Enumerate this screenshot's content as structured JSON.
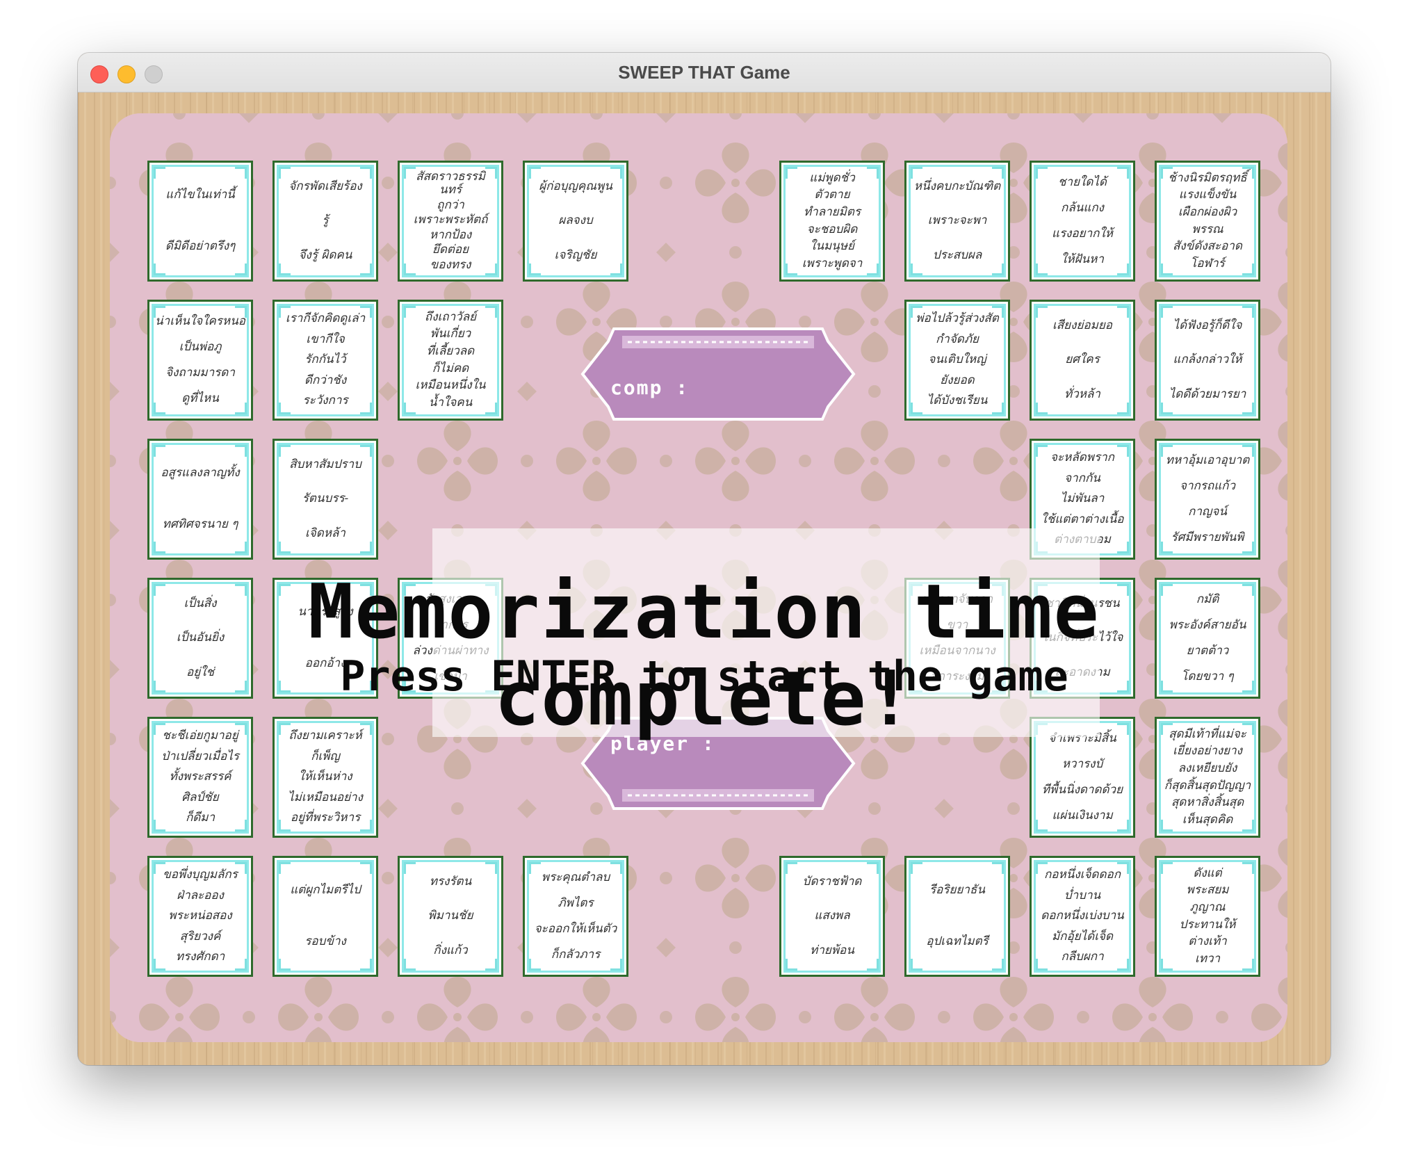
{
  "window": {
    "title": "SWEEP THAT Game"
  },
  "labels": {
    "comp": "comp :",
    "player": "player :"
  },
  "message": {
    "main": "Memorization time complete!",
    "sub": "Press ENTER to start the game"
  },
  "cards": [
    {
      "lines": [
        "แก้ไขในเท่านี้",
        "ดีมิดีอย่าตรึงๆ"
      ]
    },
    {
      "lines": [
        "จักรพัดเสียร้อง",
        "รู้",
        "จึงรู้ ผิดคน"
      ]
    },
    {
      "lines": [
        "สัสดราวธรรมินทร์",
        "ถูกว่า",
        "เพราะพระหัตถ์",
        "หากป้อง",
        "ยึดต่อย",
        "ของทรง"
      ]
    },
    {
      "lines": [
        "ผู้ก่อบุญคุณพูน",
        "ผลจงบ",
        "เจริญชัย"
      ]
    },
    {
      "lines": [
        "แม่พูดชั่ว",
        "ตัวตาย",
        "ทำลายมิตร",
        "จะชอบผิด",
        "ในมนุษย์",
        "เพราะพูดจา"
      ]
    },
    {
      "lines": [
        "หนึ่งคบกะบัณฑิต",
        "เพราะจะพา",
        "ประสบผล"
      ]
    },
    {
      "lines": [
        "ชายใดได้",
        "กล้นแกง",
        "แรงอยากให้",
        "ให้ฝันหา"
      ]
    },
    {
      "lines": [
        "ช้างนิรมิตรฤทธิ์",
        "แรงแข็งขัน",
        "เผือกผ่องผิว",
        "พรรณ",
        "สังข์ดังสะอาด",
        "โอฬาร์"
      ]
    },
    {
      "lines": [
        "น่าเห็นใจใครหนอ",
        "เป็นพ่อภู",
        "จิงถามมารดา",
        "ดูที่ไหน"
      ]
    },
    {
      "lines": [
        "เรากีจักคิดดูเล่า",
        "เขากีใจ",
        "รักกันไว้",
        "ดีกว่าชัง",
        "ระวังการ"
      ]
    },
    {
      "lines": [
        "ถึงเถาวัลย์",
        "พันเกี่ยว",
        "ที่เลี้ยวลด",
        "ก็ไม่คด",
        "เหมือนหนึ่งใน",
        "น้ำใจคน"
      ]
    },
    {
      "lines": [
        "พ่อไปล้วรู้ส่วงสัต",
        "กำจัดภัย",
        "จนเติบใหญ่",
        "ยังยอด",
        "ได้บังชเรียน"
      ]
    },
    {
      "lines": [
        "เสียงย่อมยอ",
        "ยศใคร",
        "ทั่วหล้า"
      ]
    },
    {
      "lines": [
        "ได้ฟังอรู้ก็ดีใจ",
        "แกล้งกล่าวให้",
        "ไดดีด้วยมารยา"
      ]
    },
    {
      "lines": [
        "อสูรแลงลาญทั้ง",
        "ทศทิศจรนาย ๆ"
      ]
    },
    {
      "lines": [
        "สิบหาสัมปราบ",
        "รัตนบรร-",
        "เจิดหล้า"
      ]
    },
    {
      "lines": [
        "จะหลัดพราก",
        "จากกัน",
        "ไม่พันลา",
        "ใช้แต่ตาต่างเนื้อ",
        "ต่างตาบอม"
      ]
    },
    {
      "lines": [
        "ทหาอุ้มเอาอุบาต",
        "จากรถแก้ว",
        "กาญจน์",
        "รัศมีพรายพันพิ"
      ]
    },
    {
      "lines": [
        "เป็นสิ่ง",
        "เป็นอันยิ่ง",
        "อยู่ใช่"
      ]
    },
    {
      "lines": [
        "นามระสูยิ่ง",
        "ออกอ้าง"
      ]
    },
    {
      "lines": [
        "สังสูงเวหา",
        "หาการ",
        "ล่วงด่านผ่าทาง",
        "เข้ามา"
      ]
    },
    {
      "lines": [
        "ทพรากจับจาก",
        "ขวา",
        "เหมือนจากนาง",
        "สการะงาม"
      ]
    },
    {
      "lines": [
        "ชาติหนึ่งนรชน",
        "ในกิจที่ประไว้ใจ",
        "สะอาดงาม"
      ]
    },
    {
      "lines": [
        "กมัติ",
        "พระอังค์สายอัน",
        "ยาตต้าว",
        "โดยขวา ๆ"
      ]
    },
    {
      "lines": [
        "ชะชีเอ่ยกูมาอยู่",
        "ป่าเปลี่ยวเมื่อไร",
        "ทั้งพระสรรค์",
        "ศิลป์ชัย",
        "ก็ดีมา"
      ]
    },
    {
      "lines": [
        "ถึงยามเคราะห์",
        "ก็เพ็ญ",
        "ให้เห็นห่าง",
        "ไม่เหมือนอย่าง",
        "อยู่ที่พระวิหาร"
      ]
    },
    {
      "lines": [
        "จำเพราะมิสิ้น",
        "หวารงบั",
        "ทีพื้นนิ่งดาดด้วย",
        "แผ่นเงินงาม"
      ]
    },
    {
      "lines": [
        "สุดมีเท้าที่แม่จะ",
        "เยี่ยงอย่างยาง",
        "ลงเหยียบยัง",
        "ก็สุดสิ้นสุดปัญญา",
        "สุดหาสิ่งสิ้นสุด",
        "เห็นสุดคิด"
      ]
    },
    {
      "lines": [
        "ขอพึ่งบุญมลักร",
        "ฝ่าละออง",
        "พระหน่อสอง",
        "สุริยวงค์",
        "ทรงศักดา"
      ]
    },
    {
      "lines": [
        "แต่ผูกไมตรีไป",
        "รอบข้าง"
      ]
    },
    {
      "lines": [
        "ทรงรัตน",
        "พิมานชัย",
        "กิ่งแก้ว"
      ]
    },
    {
      "lines": [
        "พระคุณตำลบ",
        "ภิพไตร",
        "จะออกให้เห็นตัว",
        "ก็กลัวภาร"
      ]
    },
    {
      "lines": [
        "บัดราชฟ้าด",
        "แสงพล",
        "ท่ายพ้อน"
      ]
    },
    {
      "lines": [
        "รีอริยยาธัน",
        "อุปเฉทไมตรี"
      ]
    },
    {
      "lines": [
        "กอหนึ่งเจ็ดดอก",
        "บ่ำบาน",
        "ดอกหนึ่งเบ่งบาน",
        "มักอุ้ยได้เจ็ด",
        "กลีบผกา"
      ]
    },
    {
      "lines": [
        "ดังแต่",
        "พระสยม",
        "ภูญาณ",
        "ประทานให้",
        "ต่างเท้า",
        "เทวา"
      ]
    }
  ],
  "colors": {
    "board": "#e2bfcc",
    "banner": "#b98abc",
    "card_border": "#2e6a2c",
    "card_inner": "#8ee8e8"
  }
}
